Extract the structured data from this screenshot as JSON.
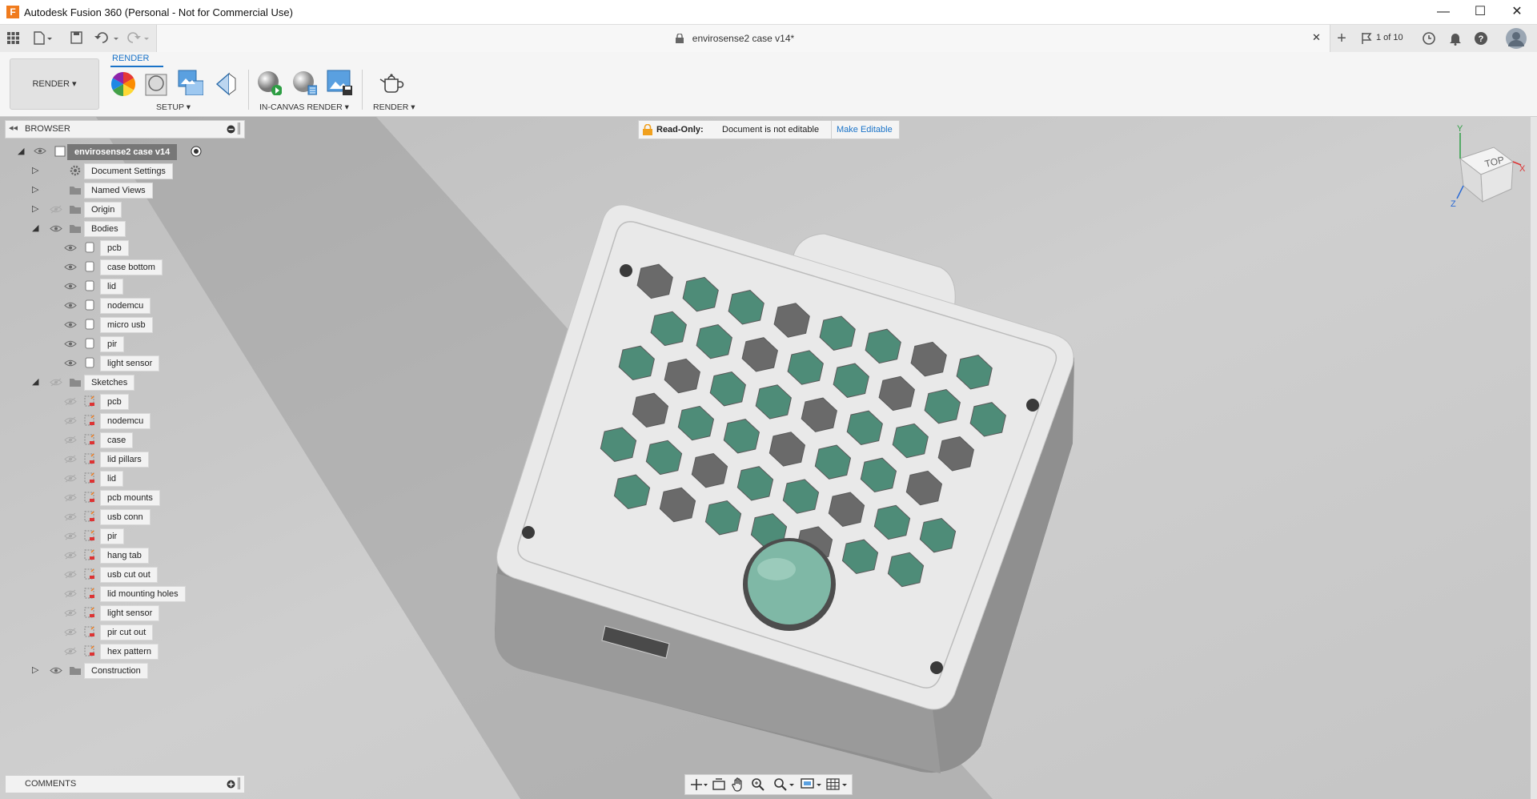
{
  "window": {
    "title": "Autodesk Fusion 360 (Personal - Not for Commercial Use)",
    "logo_letter": "F",
    "minimize": "—",
    "maximize": "☐",
    "close": "✕"
  },
  "tabs": {
    "document_title": "envirosense2 case v14*",
    "close_tab": "✕",
    "new_tab": "+",
    "job_status": "1 of 10"
  },
  "ribbon": {
    "workspace": "RENDER ▾",
    "active_tab": "RENDER",
    "groups": [
      "SETUP ▾",
      "IN-CANVAS RENDER ▾",
      "RENDER ▾"
    ]
  },
  "browser": {
    "header": "BROWSER",
    "root": "envirosense2 case v14",
    "items": [
      {
        "label": "Document Settings",
        "level": 1,
        "expander": "closed",
        "eye": false,
        "icon": "gear-icon"
      },
      {
        "label": "Named Views",
        "level": 1,
        "expander": "closed",
        "eye": false,
        "icon": "folder-icon"
      },
      {
        "label": "Origin",
        "level": 1,
        "expander": "closed",
        "eye": "hidden",
        "icon": "folder-icon"
      },
      {
        "label": "Bodies",
        "level": 1,
        "expander": "open",
        "eye": "visible",
        "icon": "folder-icon"
      },
      {
        "label": "pcb",
        "level": 2,
        "eye": "visible",
        "icon": "body-icon"
      },
      {
        "label": "case bottom",
        "level": 2,
        "eye": "visible",
        "icon": "body-icon"
      },
      {
        "label": "lid",
        "level": 2,
        "eye": "visible",
        "icon": "body-icon"
      },
      {
        "label": "nodemcu",
        "level": 2,
        "eye": "visible",
        "icon": "body-icon"
      },
      {
        "label": "micro usb",
        "level": 2,
        "eye": "visible",
        "icon": "body-icon"
      },
      {
        "label": "pir",
        "level": 2,
        "eye": "visible",
        "icon": "body-icon"
      },
      {
        "label": "light sensor",
        "level": 2,
        "eye": "visible",
        "icon": "body-icon"
      },
      {
        "label": "Sketches",
        "level": 1,
        "expander": "open",
        "eye": "hidden",
        "icon": "folder-icon"
      },
      {
        "label": "pcb",
        "level": 2,
        "eye": "hidden",
        "icon": "sketch-icon"
      },
      {
        "label": "nodemcu",
        "level": 2,
        "eye": "hidden",
        "icon": "sketch-icon"
      },
      {
        "label": "case",
        "level": 2,
        "eye": "hidden",
        "icon": "sketch-icon"
      },
      {
        "label": "lid pillars",
        "level": 2,
        "eye": "hidden",
        "icon": "sketch-icon"
      },
      {
        "label": "lid",
        "level": 2,
        "eye": "hidden",
        "icon": "sketch-icon"
      },
      {
        "label": "pcb mounts",
        "level": 2,
        "eye": "hidden",
        "icon": "sketch-icon"
      },
      {
        "label": "usb conn",
        "level": 2,
        "eye": "hidden",
        "icon": "sketch-icon"
      },
      {
        "label": "pir",
        "level": 2,
        "eye": "hidden",
        "icon": "sketch-icon"
      },
      {
        "label": "hang tab",
        "level": 2,
        "eye": "hidden",
        "icon": "sketch-icon"
      },
      {
        "label": "usb cut out",
        "level": 2,
        "eye": "hidden",
        "icon": "sketch-icon"
      },
      {
        "label": "lid mounting holes",
        "level": 2,
        "eye": "hidden",
        "icon": "sketch-icon"
      },
      {
        "label": "light sensor",
        "level": 2,
        "eye": "hidden",
        "icon": "sketch-icon"
      },
      {
        "label": "pir cut out",
        "level": 2,
        "eye": "hidden",
        "icon": "sketch-icon"
      },
      {
        "label": "hex pattern",
        "level": 2,
        "eye": "hidden",
        "icon": "sketch-icon"
      },
      {
        "label": "Construction",
        "level": 1,
        "expander": "closed",
        "eye": "visible",
        "icon": "folder-icon"
      }
    ]
  },
  "readonly": {
    "title": "Read-Only:",
    "message": "Document is not editable",
    "action": "Make Editable"
  },
  "viewcube": {
    "face": "TOP",
    "x": "X",
    "y": "Y",
    "z": "Z"
  },
  "comments": {
    "label": "COMMENTS"
  },
  "colors": {
    "accent": "#1a73c8",
    "lid": "#e8e8e8",
    "pcb": "#4e8c78"
  }
}
